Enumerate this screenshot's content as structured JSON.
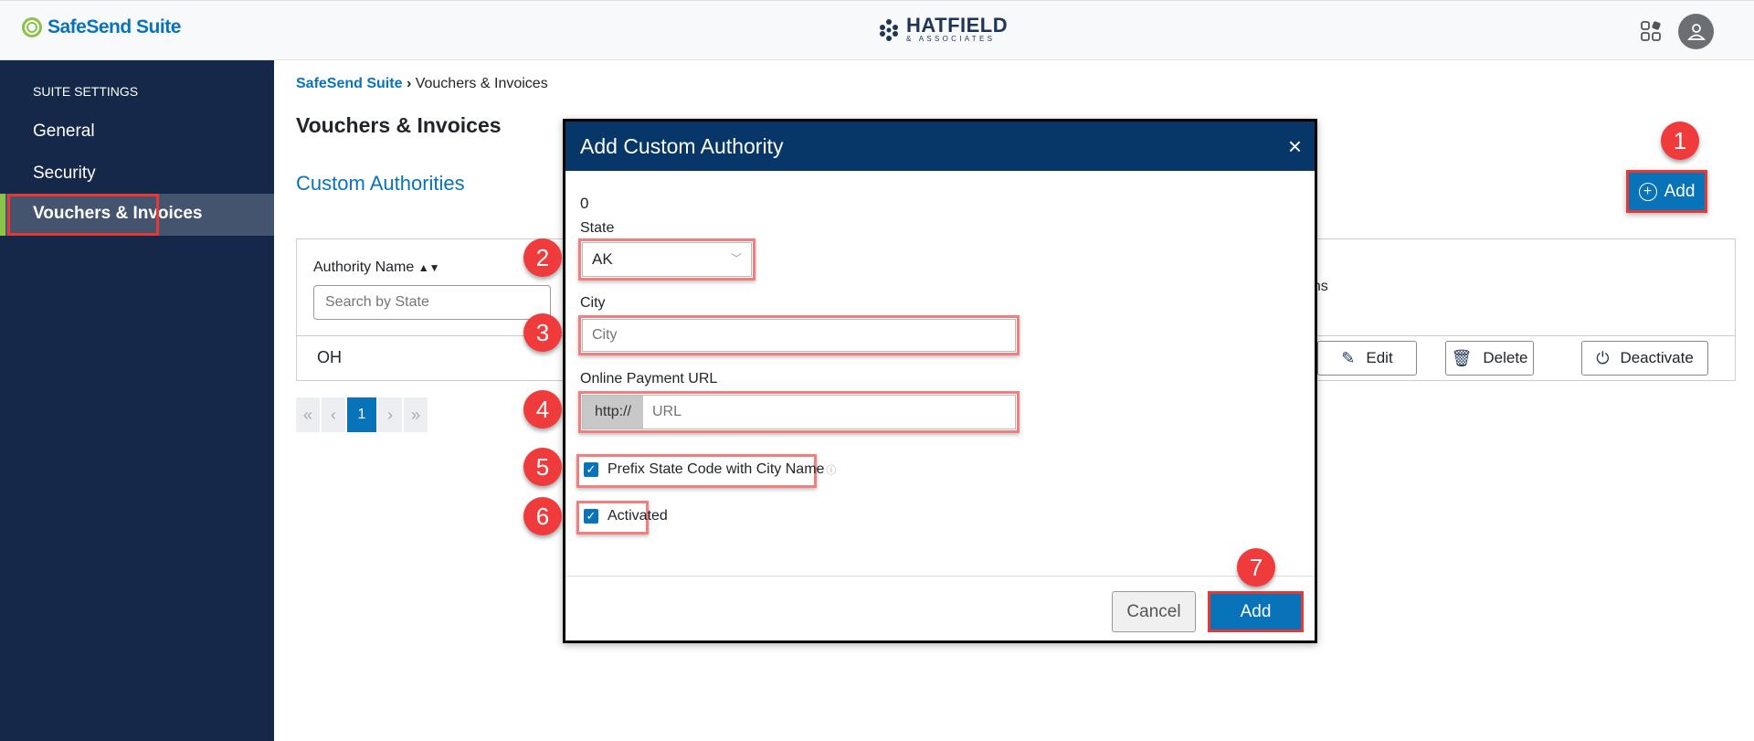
{
  "header": {
    "brand": "SafeSend Suite",
    "company_logo": "HATFIELD & ASSOCIATES",
    "company_name": "HATFIELD",
    "company_sub": "& ASSOCIATES",
    "apps_icon": "apps-grid-icon",
    "avatar_icon": "user-icon"
  },
  "sidebar": {
    "heading": "SUITE SETTINGS",
    "items": [
      {
        "label": "General"
      },
      {
        "label": "Security"
      },
      {
        "label": "Vouchers & Invoices",
        "active": true
      }
    ]
  },
  "breadcrumb": {
    "root": "SafeSend Suite",
    "separator": "›",
    "current": "Vouchers & Invoices"
  },
  "page": {
    "title": "Vouchers & Invoices",
    "section": "Custom Authorities",
    "add_label": "Add"
  },
  "table": {
    "col_authority": "Authority Name",
    "search_placeholder": "Search by State",
    "col_actions": "tions",
    "rows": [
      {
        "name": "OH",
        "edit": "Edit",
        "delete": "Delete",
        "deactivate": "Deactivate"
      }
    ]
  },
  "pagination": {
    "first": "«",
    "prev": "‹",
    "current": "1",
    "next": "›",
    "last": "»"
  },
  "modal": {
    "title": "Add Custom Authority",
    "close": "×",
    "count": "0",
    "state_label": "State",
    "state_value": "AK",
    "city_label": "City",
    "city_placeholder": "City",
    "url_label": "Online Payment URL",
    "url_prefix": "http://",
    "url_placeholder": "URL",
    "prefix_label": "Prefix State Code with City Name",
    "prefix_checked": true,
    "activated_label": "Activated",
    "activated_checked": true,
    "cancel_label": "Cancel",
    "add_label": "Add"
  },
  "badges": [
    "1",
    "2",
    "3",
    "4",
    "5",
    "6",
    "7"
  ],
  "colors": {
    "accent": "#0973ba",
    "sidebar": "#15284a",
    "modal_header": "#073668",
    "highlight": "#e53935",
    "badge": "#ef3b3b"
  }
}
